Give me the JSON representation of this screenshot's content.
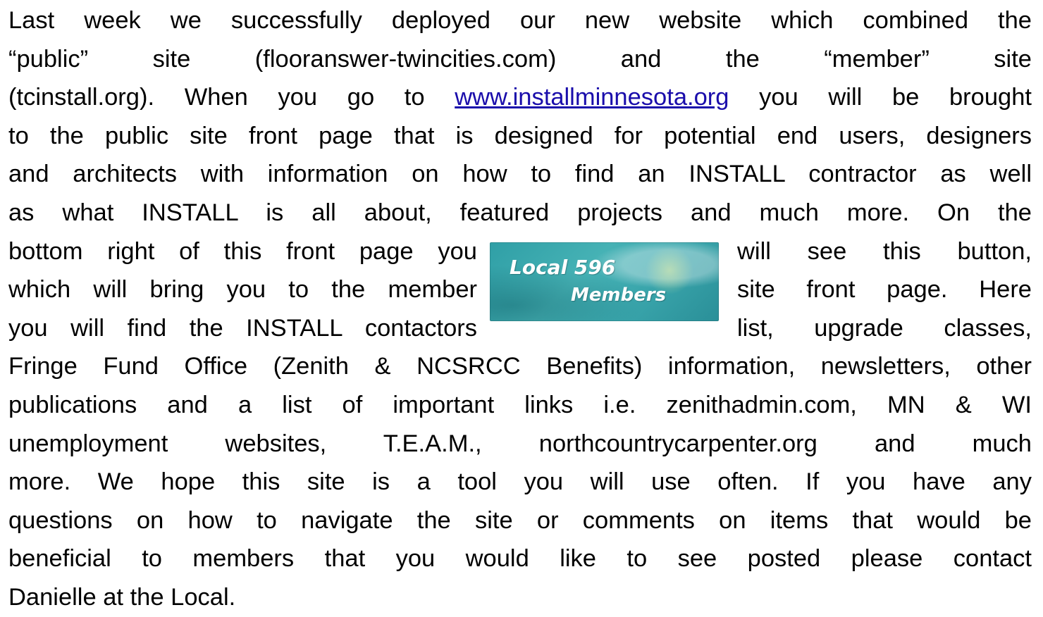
{
  "paragraph": {
    "lines": [
      "Last week we successfully deployed our new website which combined the",
      "“public” site (flooranswer-twincities.com) and the “member” site",
      "to the public site front page that is designed for potential end users, designers",
      "and architects with information on how to find an INSTALL contractor as well",
      "as what INSTALL is all about, featured projects and much more.  On the"
    ],
    "line3_before": "(tcinstall.org).  When you go to ",
    "link_text": "www.installminnesota.org",
    "line3_after": " you will be brought",
    "float_left": [
      "bottom right of this front page you",
      "which will bring you to the member",
      "you will find the INSTALL contactors"
    ],
    "float_right": [
      "will see this button,",
      "site front page.  Here",
      "list, upgrade classes,"
    ],
    "after_lines": [
      "Fringe Fund Office (Zenith & NCSRCC Benefits) information, newsletters, other",
      "publications and a list of important links i.e. zenithadmin.com, MN & WI",
      "unemployment websites, T.E.A.M., northcountrycarpenter.org and much",
      "more.    We hope this site is a tool you will use often.  If you have any",
      "questions on how to navigate the site or comments on items that would be",
      "beneficial to members that you would like to see posted please contact"
    ],
    "last_line": "Danielle at the Local."
  },
  "members_button": {
    "line1": "Local 596",
    "line2": "Members",
    "colors": {
      "background": "#3aa6ac",
      "text": "#ffffff"
    }
  },
  "colors": {
    "link": "#1a0dab",
    "text": "#000000"
  }
}
